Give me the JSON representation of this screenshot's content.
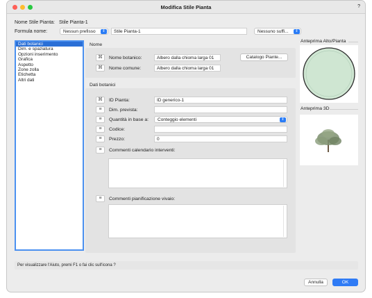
{
  "window": {
    "title": "Modifica Stile Pianta",
    "help": "?"
  },
  "header": {
    "name_label": "Nome Stile Pianta:",
    "name_value": "Stile Pianta-1",
    "formula_label": "Formula nome:",
    "prefix_popup": "Nessun prefisso",
    "name_field": "Stile Pianta-1",
    "suffix_popup": "Nessuno suffi..."
  },
  "sidebar": {
    "items": [
      {
        "label": "Dati botanici",
        "selected": true
      },
      {
        "label": "Dim. e spaziatura",
        "selected": false
      },
      {
        "label": "Opzioni inserimento",
        "selected": false
      },
      {
        "label": "Grafica",
        "selected": false
      },
      {
        "label": "Aspetto",
        "selected": false
      },
      {
        "label": "Zone zolla",
        "selected": false
      },
      {
        "label": "Etichetta",
        "selected": false
      },
      {
        "label": "Altri dati",
        "selected": false
      }
    ]
  },
  "nome_section": {
    "heading": "Nome",
    "botanical_label": "Nome botanico:",
    "botanical_value": "Albero dalla chioma larga 01",
    "catalog_button": "Catalogo Piante...",
    "common_label": "Nome comune:",
    "common_value": "Albero dalla chioma larga 01"
  },
  "botanical_section": {
    "heading": "Dati botanici",
    "plant_id_label": "ID Pianta:",
    "plant_id_value": "ID generico-1",
    "size_label": "Dim. prevista:",
    "size_value": "",
    "quantity_label": "Quantità in base a:",
    "quantity_value": "Conteggio elementi",
    "code_label": "Codice:",
    "code_value": "",
    "price_label": "Prezzo:",
    "price_value": "0",
    "calendar_label": "Commenti calendario interventi:",
    "nursery_label": "Commenti pianificazione vivaio:"
  },
  "previews": {
    "top_label": "Anteprima Alto/Pianta",
    "three_d_label": "Anteprima 3D"
  },
  "hint": "Per visualizzare l'Aiuto, premi F1 o fai clic sull'icona ?",
  "footer": {
    "cancel": "Annulla",
    "ok": "OK"
  },
  "colors": {
    "accent": "#2f7bf5",
    "canopy_fill": "#cfe6d2",
    "canopy_stroke": "#2a2a2a"
  },
  "icons": {
    "field_button": "cycle-icon",
    "popup_arrow": "chevron-updown-icon"
  }
}
